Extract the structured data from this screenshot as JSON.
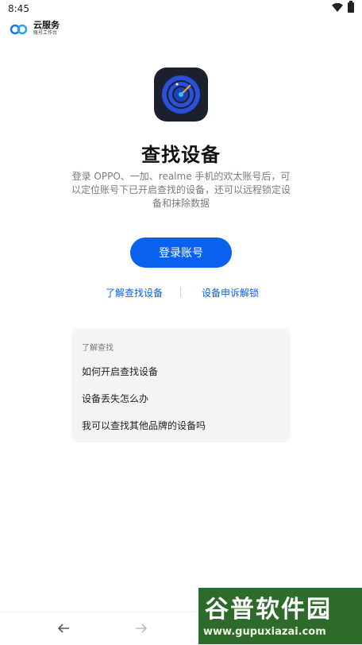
{
  "status_bar": {
    "time": "8:45"
  },
  "brand": {
    "name": "云服务",
    "subtitle": "账号工作台"
  },
  "page": {
    "title": "查找设备",
    "description": "登录 OPPO、一加、realme 手机的欢太账号后，可以定位账号下已开启查找的设备，还可以远程锁定设备和抹除数据",
    "login_button": "登录账号",
    "links": {
      "learn": "了解查找设备",
      "appeal_unlock": "设备申诉解锁"
    }
  },
  "faq_card": {
    "header": "了解查找",
    "items": [
      {
        "label": "如何开启查找设备"
      },
      {
        "label": "设备丢失怎么办"
      },
      {
        "label": "我可以查找其他品牌的设备吗"
      }
    ]
  },
  "watermark": {
    "text": "谷普软件园",
    "url": "www.gupuxiazai.com"
  },
  "colors": {
    "accent": "#0a61f0",
    "card_bg": "#f4f4f4",
    "icon_bg": "#1b1f2e",
    "watermark_bg": "#2e6b2a"
  }
}
